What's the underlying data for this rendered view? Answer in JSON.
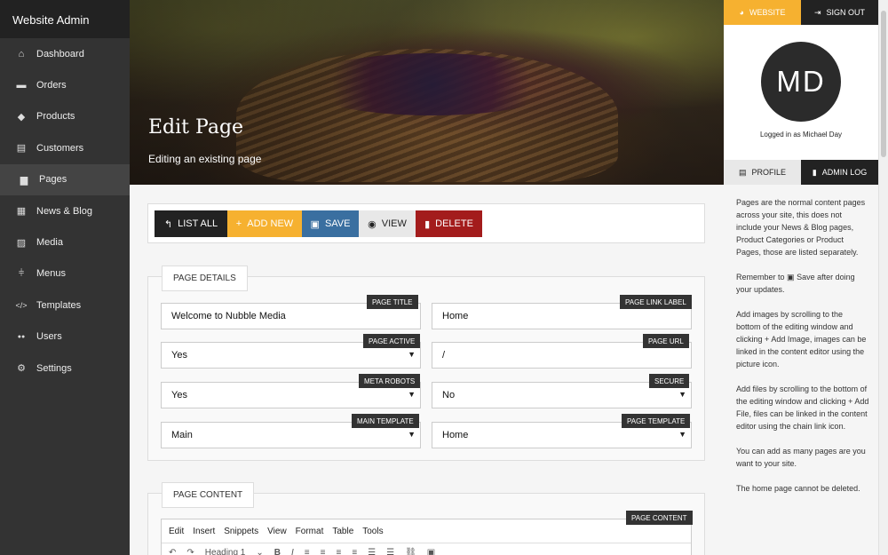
{
  "sidebar": {
    "brand": "Website Admin",
    "items": [
      {
        "label": "Dashboard",
        "icon": "home-icon",
        "glyph": "⌂"
      },
      {
        "label": "Orders",
        "icon": "credit-card-icon",
        "glyph": "▬"
      },
      {
        "label": "Products",
        "icon": "tag-icon",
        "glyph": "◆"
      },
      {
        "label": "Customers",
        "icon": "id-card-icon",
        "glyph": "▤"
      },
      {
        "label": "Pages",
        "icon": "file-icon",
        "glyph": "▆"
      },
      {
        "label": "News & Blog",
        "icon": "calendar-icon",
        "glyph": "▦"
      },
      {
        "label": "Media",
        "icon": "image-icon",
        "glyph": "▨"
      },
      {
        "label": "Menus",
        "icon": "signpost-icon",
        "glyph": "⫩"
      },
      {
        "label": "Templates",
        "icon": "code-icon",
        "glyph": "</>"
      },
      {
        "label": "Users",
        "icon": "users-icon",
        "glyph": "●●"
      },
      {
        "label": "Settings",
        "icon": "gear-icon",
        "glyph": "⚙"
      }
    ]
  },
  "hero": {
    "title": "Edit Page",
    "subtitle": "Editing an existing page"
  },
  "toolbar": {
    "list_all": "LIST ALL",
    "add_new": "ADD NEW",
    "save": "SAVE",
    "view": "VIEW",
    "delete": "DELETE"
  },
  "page_details": {
    "legend": "PAGE DETAILS",
    "page_title": {
      "label": "PAGE TITLE",
      "value": "Welcome to Nubble Media"
    },
    "page_link_label": {
      "label": "PAGE LINK LABEL",
      "value": "Home"
    },
    "page_active": {
      "label": "PAGE ACTIVE",
      "value": "Yes"
    },
    "page_url": {
      "label": "PAGE URL",
      "value": "/"
    },
    "meta_robots": {
      "label": "META ROBOTS",
      "value": "Yes"
    },
    "secure": {
      "label": "SECURE",
      "value": "No"
    },
    "main_template": {
      "label": "MAIN TEMPLATE",
      "value": "Main"
    },
    "page_template": {
      "label": "PAGE TEMPLATE",
      "value": "Home"
    }
  },
  "page_content": {
    "legend": "PAGE CONTENT",
    "tag": "PAGE CONTENT",
    "menu": {
      "edit": "Edit",
      "insert": "Insert",
      "snippets": "Snippets",
      "view": "View",
      "format": "Format",
      "table": "Table",
      "tools": "Tools"
    },
    "heading_select": "Heading 1"
  },
  "right": {
    "website": "WEBSITE",
    "sign_out": "SIGN OUT",
    "initials": "MD",
    "logged_in": "Logged in as Michael Day",
    "profile": "PROFILE",
    "admin_log": "ADMIN LOG",
    "help": {
      "p1": "Pages are the normal content pages across your site, this does not include your News & Blog pages, Product Categories or Product Pages, those are listed separately.",
      "p2_a": "Remember to",
      "p2_b": "Save after doing your updates.",
      "p3_a": "Add images by scrolling to the bottom of the editing window and clicking",
      "p3_b": "Add Image, images can be linked in the content editor using the picture icon.",
      "p4_a": "Add files by scrolling to the bottom of the editing window and clicking",
      "p4_b": "Add File, files can be linked in the content editor using the chain link icon.",
      "p5": "You can add as many pages are you want to your site.",
      "p6": "The home page cannot be deleted."
    }
  },
  "colors": {
    "accent": "#f6b130",
    "save": "#3a6fa0",
    "delete": "#a31c1c",
    "sidebar": "#333333"
  }
}
